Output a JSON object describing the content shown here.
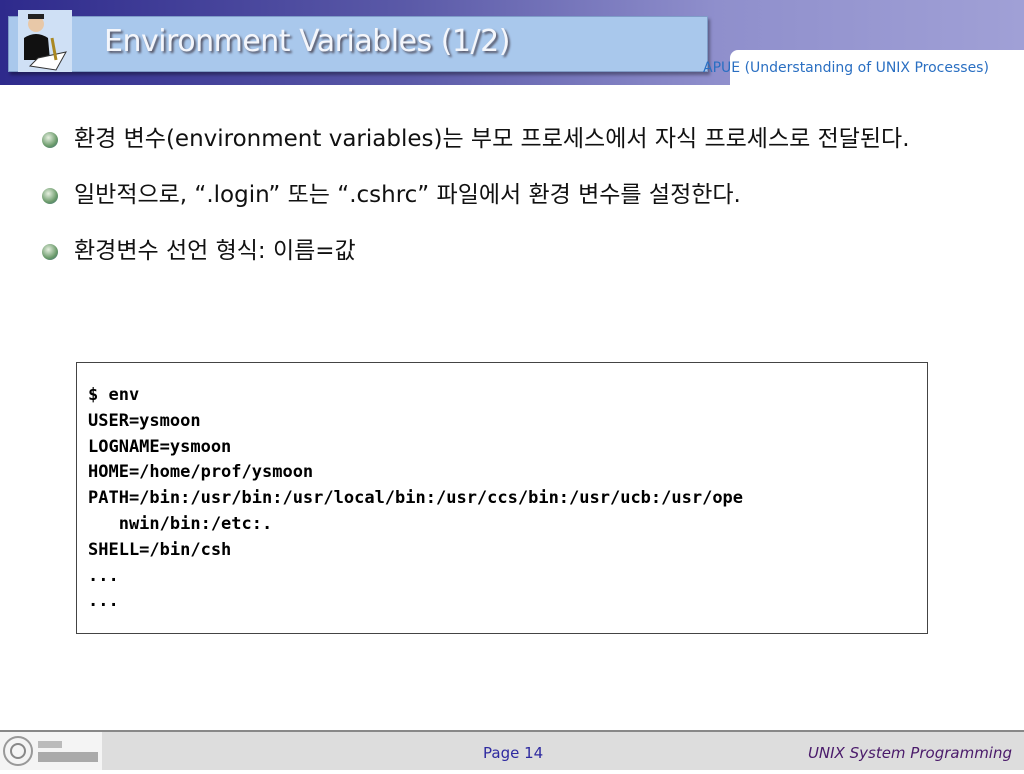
{
  "header": {
    "title": "Environment Variables (1/2)",
    "subtitle": "APUE (Understanding of UNIX Processes)"
  },
  "bullets": [
    "환경 변수(environment variables)는 부모 프로세스에서 자식 프로세스로 전달된다.",
    "일반적으로, “.login” 또는 “.cshrc” 파일에서 환경 변수를 설정한다.",
    "환경변수 선언 형식: 이름=값"
  ],
  "code": "$ env\nUSER=ysmoon\nLOGNAME=ysmoon\nHOME=/home/prof/ysmoon\nPATH=/bin:/usr/bin:/usr/local/bin:/usr/ccs/bin:/usr/ucb:/usr/ope\n   nwin/bin:/etc:.\nSHELL=/bin/csh\n...\n...",
  "footer": {
    "logo_text": "강원대학교 컴퓨터과학과",
    "page": "Page 14",
    "course": "UNIX System Programming"
  }
}
